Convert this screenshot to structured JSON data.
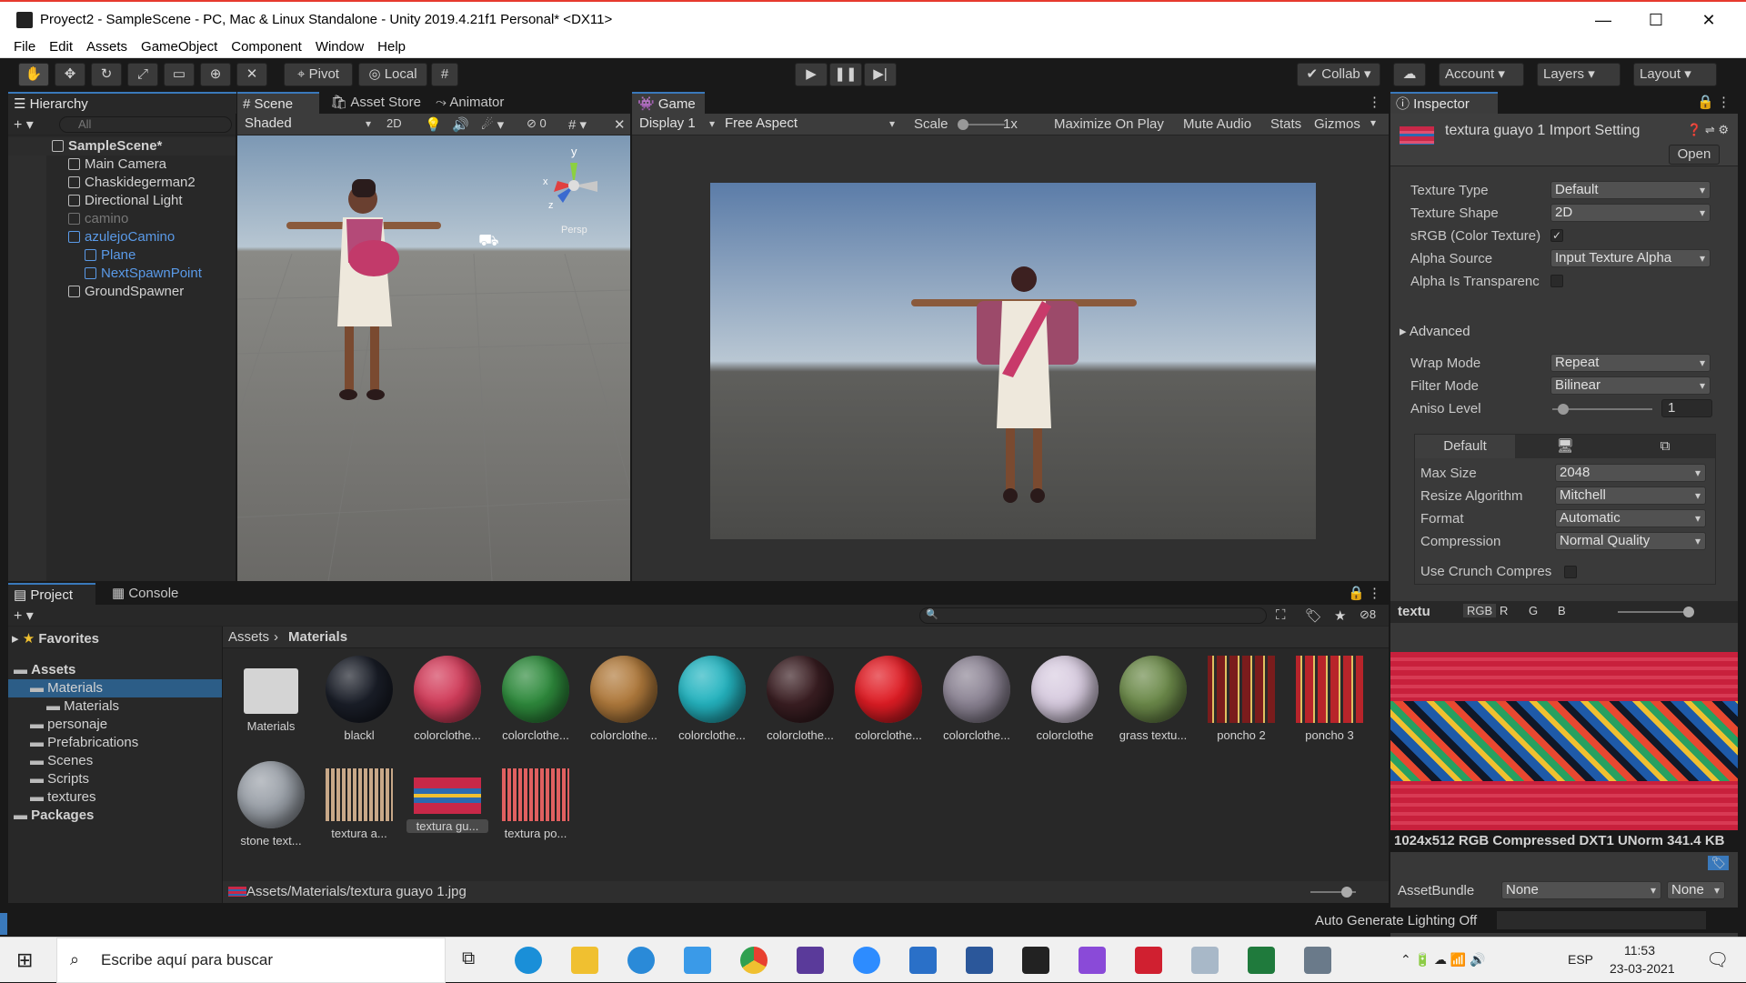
{
  "window": {
    "title": "Proyect2 - SampleScene - PC, Mac & Linux Standalone - Unity 2019.4.21f1 Personal* <DX11>",
    "controls": [
      "—",
      "☐",
      "✕"
    ]
  },
  "menu": [
    "File",
    "Edit",
    "Assets",
    "GameObject",
    "Component",
    "Window",
    "Help"
  ],
  "toolbar": {
    "pivot": "Pivot",
    "local": "Local",
    "collab": "Collab",
    "account": "Account",
    "layers": "Layers",
    "layout": "Layout"
  },
  "hierarchy": {
    "tab": "Hierarchy",
    "search_placeholder": "All",
    "items": [
      {
        "label": "SampleScene*",
        "indent": 0,
        "style": "scene"
      },
      {
        "label": "Main Camera",
        "indent": 1,
        "style": "normal"
      },
      {
        "label": "Chaskidegerman2",
        "indent": 1,
        "style": "normal"
      },
      {
        "label": "Directional Light",
        "indent": 1,
        "style": "normal"
      },
      {
        "label": "camino",
        "indent": 1,
        "style": "disabled"
      },
      {
        "label": "azulejoCamino",
        "indent": 1,
        "style": "prefab"
      },
      {
        "label": "Plane",
        "indent": 2,
        "style": "prefab"
      },
      {
        "label": "NextSpawnPoint",
        "indent": 2,
        "style": "prefab"
      },
      {
        "label": "GroundSpawner",
        "indent": 1,
        "style": "normal"
      }
    ]
  },
  "scene": {
    "tabs": [
      "Scene",
      "Asset Store",
      "Animator"
    ],
    "shading": "Shaded",
    "mode2d": "2D",
    "hidden_count": "0",
    "gizmo_x": "x",
    "gizmo_y": "y",
    "gizmo_z": "z",
    "persp": "Persp"
  },
  "game": {
    "tab": "Game",
    "display": "Display 1",
    "aspect": "Free Aspect",
    "scale_label": "Scale",
    "scale_value": "1x",
    "maximize": "Maximize On Play",
    "mute": "Mute Audio",
    "stats": "Stats",
    "gizmos": "Gizmos"
  },
  "inspector": {
    "tab": "Inspector",
    "title": "textura guayo 1 Import Setting",
    "open": "Open",
    "rows": [
      {
        "label": "Texture Type",
        "value": "Default",
        "type": "dropdown"
      },
      {
        "label": "Texture Shape",
        "value": "2D",
        "type": "dropdown"
      },
      {
        "label": "sRGB (Color Texture)",
        "value": "✓",
        "type": "check"
      },
      {
        "label": "Alpha Source",
        "value": "Input Texture Alpha",
        "type": "dropdown"
      },
      {
        "label": "Alpha Is Transparenc",
        "value": "",
        "type": "check"
      }
    ],
    "advanced": "Advanced",
    "wrap_label": "Wrap Mode",
    "wrap": "Repeat",
    "filter_label": "Filter Mode",
    "filter": "Bilinear",
    "aniso_label": "Aniso Level",
    "aniso": "1",
    "platform_tab": "Default",
    "platform_rows": [
      {
        "label": "Max Size",
        "value": "2048"
      },
      {
        "label": "Resize Algorithm",
        "value": "Mitchell"
      },
      {
        "label": "Format",
        "value": "Automatic"
      },
      {
        "label": "Compression",
        "value": "Normal Quality"
      }
    ],
    "crunch": "Use Crunch Compres",
    "preview_name": "textu",
    "channels": [
      "RGB",
      "R",
      "G",
      "B"
    ],
    "preview_info": "1024x512  RGB Compressed DXT1 UNorm   341.4 KB",
    "assetbundle_label": "AssetBundle",
    "assetbundle": "None",
    "assetbundle_variant": "None"
  },
  "project": {
    "tabs": [
      "Project",
      "Console"
    ],
    "hidden_count": "8",
    "favorites": "Favorites",
    "tree": [
      {
        "label": "Assets",
        "indent": 0,
        "bold": true
      },
      {
        "label": "Materials",
        "indent": 1,
        "bold": false
      },
      {
        "label": "Materials",
        "indent": 2,
        "bold": false
      },
      {
        "label": "personaje",
        "indent": 1,
        "bold": false
      },
      {
        "label": "Prefabrications",
        "indent": 1,
        "bold": false
      },
      {
        "label": "Scenes",
        "indent": 1,
        "bold": false
      },
      {
        "label": "Scripts",
        "indent": 1,
        "bold": false
      },
      {
        "label": "textures",
        "indent": 1,
        "bold": false
      },
      {
        "label": "Packages",
        "indent": 0,
        "bold": true
      }
    ],
    "breadcrumb": [
      "Assets",
      "Materials"
    ],
    "assets": [
      {
        "label": "Materials",
        "kind": "folder",
        "color": "#c8c8c8"
      },
      {
        "label": "blackl",
        "kind": "sphere",
        "color": "#1a1e28"
      },
      {
        "label": "colorclothe...",
        "kind": "sphere",
        "color": "#d23c5a"
      },
      {
        "label": "colorclothe...",
        "kind": "sphere",
        "color": "#2e8a3c"
      },
      {
        "label": "colorclothe...",
        "kind": "sphere",
        "color": "#b07a3c"
      },
      {
        "label": "colorclothe...",
        "kind": "sphere",
        "color": "#24b4c0"
      },
      {
        "label": "colorclothe...",
        "kind": "sphere",
        "color": "#3a1e22"
      },
      {
        "label": "colorclothe...",
        "kind": "sphere",
        "color": "#e01c24"
      },
      {
        "label": "colorclothe...",
        "kind": "sphere",
        "color": "#8c8494"
      },
      {
        "label": "colorclothe",
        "kind": "sphere",
        "color": "#d8cce0"
      },
      {
        "label": "grass textu...",
        "kind": "sphere",
        "color": "#6c8a4a"
      },
      {
        "label": "poncho 2",
        "kind": "stripes",
        "color": "#7a1c1c"
      },
      {
        "label": "poncho 3",
        "kind": "stripes",
        "color": "#b8242a"
      },
      {
        "label": "stone text...",
        "kind": "sphere",
        "color": "#9aa0a8"
      },
      {
        "label": "textura a...",
        "kind": "square",
        "color": "#c8a888"
      },
      {
        "label": "textura gu...",
        "kind": "band",
        "color": "#c82848"
      },
      {
        "label": "textura po...",
        "kind": "square",
        "color": "#e06060"
      }
    ],
    "path": "Assets/Materials/textura guayo 1.jpg"
  },
  "status": {
    "lighting": "Auto Generate Lighting Off"
  },
  "taskbar": {
    "search": "Escribe aquí para buscar",
    "lang": "ESP",
    "time": "11:53",
    "date": "23-03-2021"
  }
}
